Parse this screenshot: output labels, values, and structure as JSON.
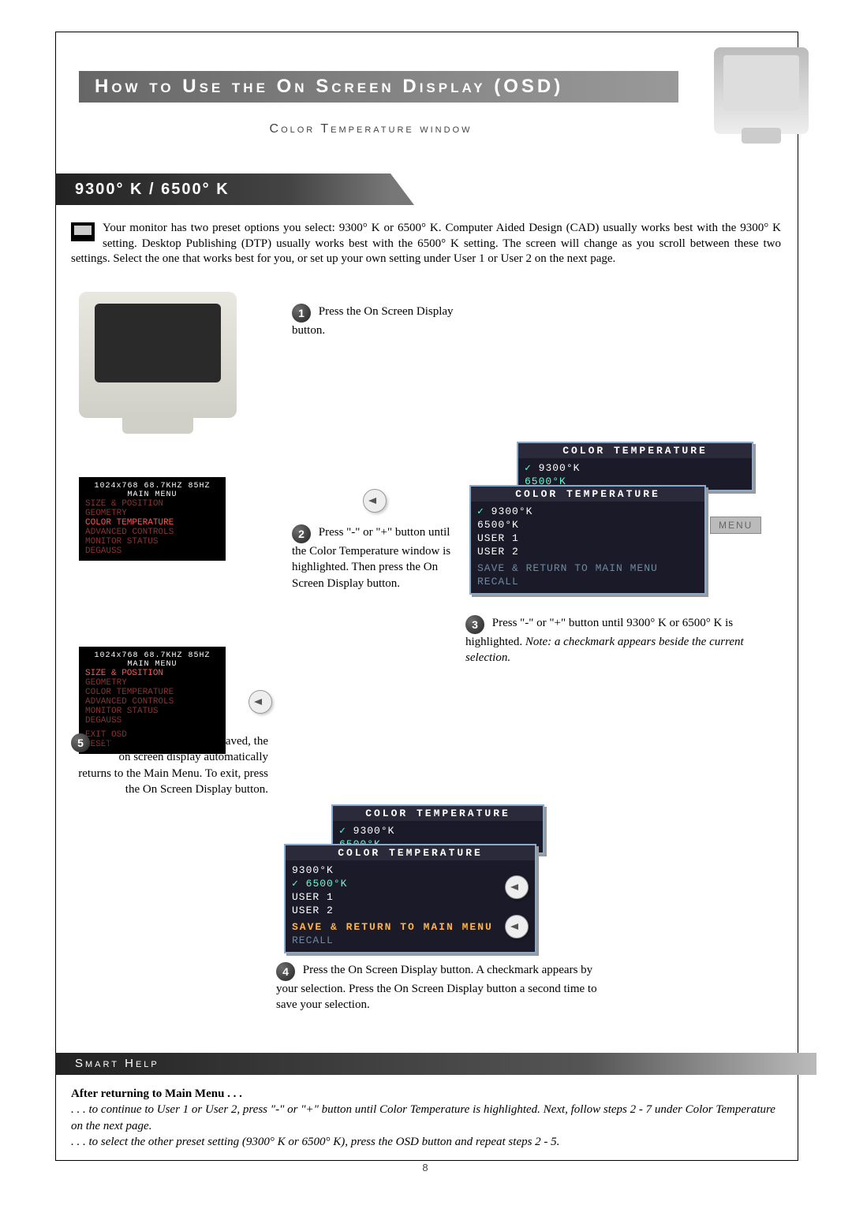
{
  "title": "How to Use the On Screen Display (OSD)",
  "subtitle": "Color Temperature window",
  "section_heading": "9300° K / 6500° K",
  "intro": "Your monitor has two preset options you select: 9300° K or 6500° K. Computer Aided Design (CAD) usually works best with the 9300° K setting. Desktop Publishing (DTP) usually works best with the 6500° K setting. The screen will change as you scroll between these two settings. Select the one that works best for you, or set up your own setting under User 1 or User 2 on the next page.",
  "steps": {
    "s1": {
      "num": "1",
      "text": "Press the On Screen Display button."
    },
    "s2": {
      "num": "2",
      "text": "Press \"-\" or \"+\" button until the Color Temperature window is highlighted. Then press the On Screen Display button."
    },
    "s3": {
      "num": "3",
      "text": "Press \"-\" or \"+\" button until 9300° K or 6500° K is highlighted. Note: a checkmark appears beside the current selection."
    },
    "s4": {
      "num": "4",
      "text": "Press the On Screen Display button. A checkmark appears by your selection. Press the On Screen Display button a second time to save your selection."
    },
    "s5": {
      "num": "5",
      "text": "After the preset setting is saved, the on screen display automatically returns to the Main Menu. To exit, press the On Screen Display button."
    }
  },
  "main_menu": {
    "res": "1024x768  68.7KHZ 85HZ",
    "title": "MAIN MENU",
    "items": [
      "SIZE & POSITION",
      "GEOMETRY",
      "COLOR TEMPERATURE",
      "ADVANCED CONTROLS",
      "MONITOR STATUS",
      "DEGAUSS",
      "",
      "EXIT OSD",
      "RESET"
    ]
  },
  "osd_small_header": "COLOR TEMPERATURE",
  "osd_options": {
    "o1": "9300°K",
    "o2": "6500°K",
    "o3": "USER 1",
    "o4": "USER 2",
    "save": "SAVE & RETURN TO MAIN MENU",
    "recall": "RECALL"
  },
  "menu_label": "MENU",
  "smart_help": {
    "title": "Smart Help",
    "heading": "After returning to Main Menu . . .",
    "line1": ". . . to continue to User 1 or User 2, press \"-\" or \"+\" button until Color Temperature is highlighted. Next, follow steps 2 - 7 under Color Temperature on the next page.",
    "line2": ". . . to select the other preset setting (9300° K or 6500° K), press the OSD button and repeat steps 2 - 5."
  },
  "page_number": "8"
}
